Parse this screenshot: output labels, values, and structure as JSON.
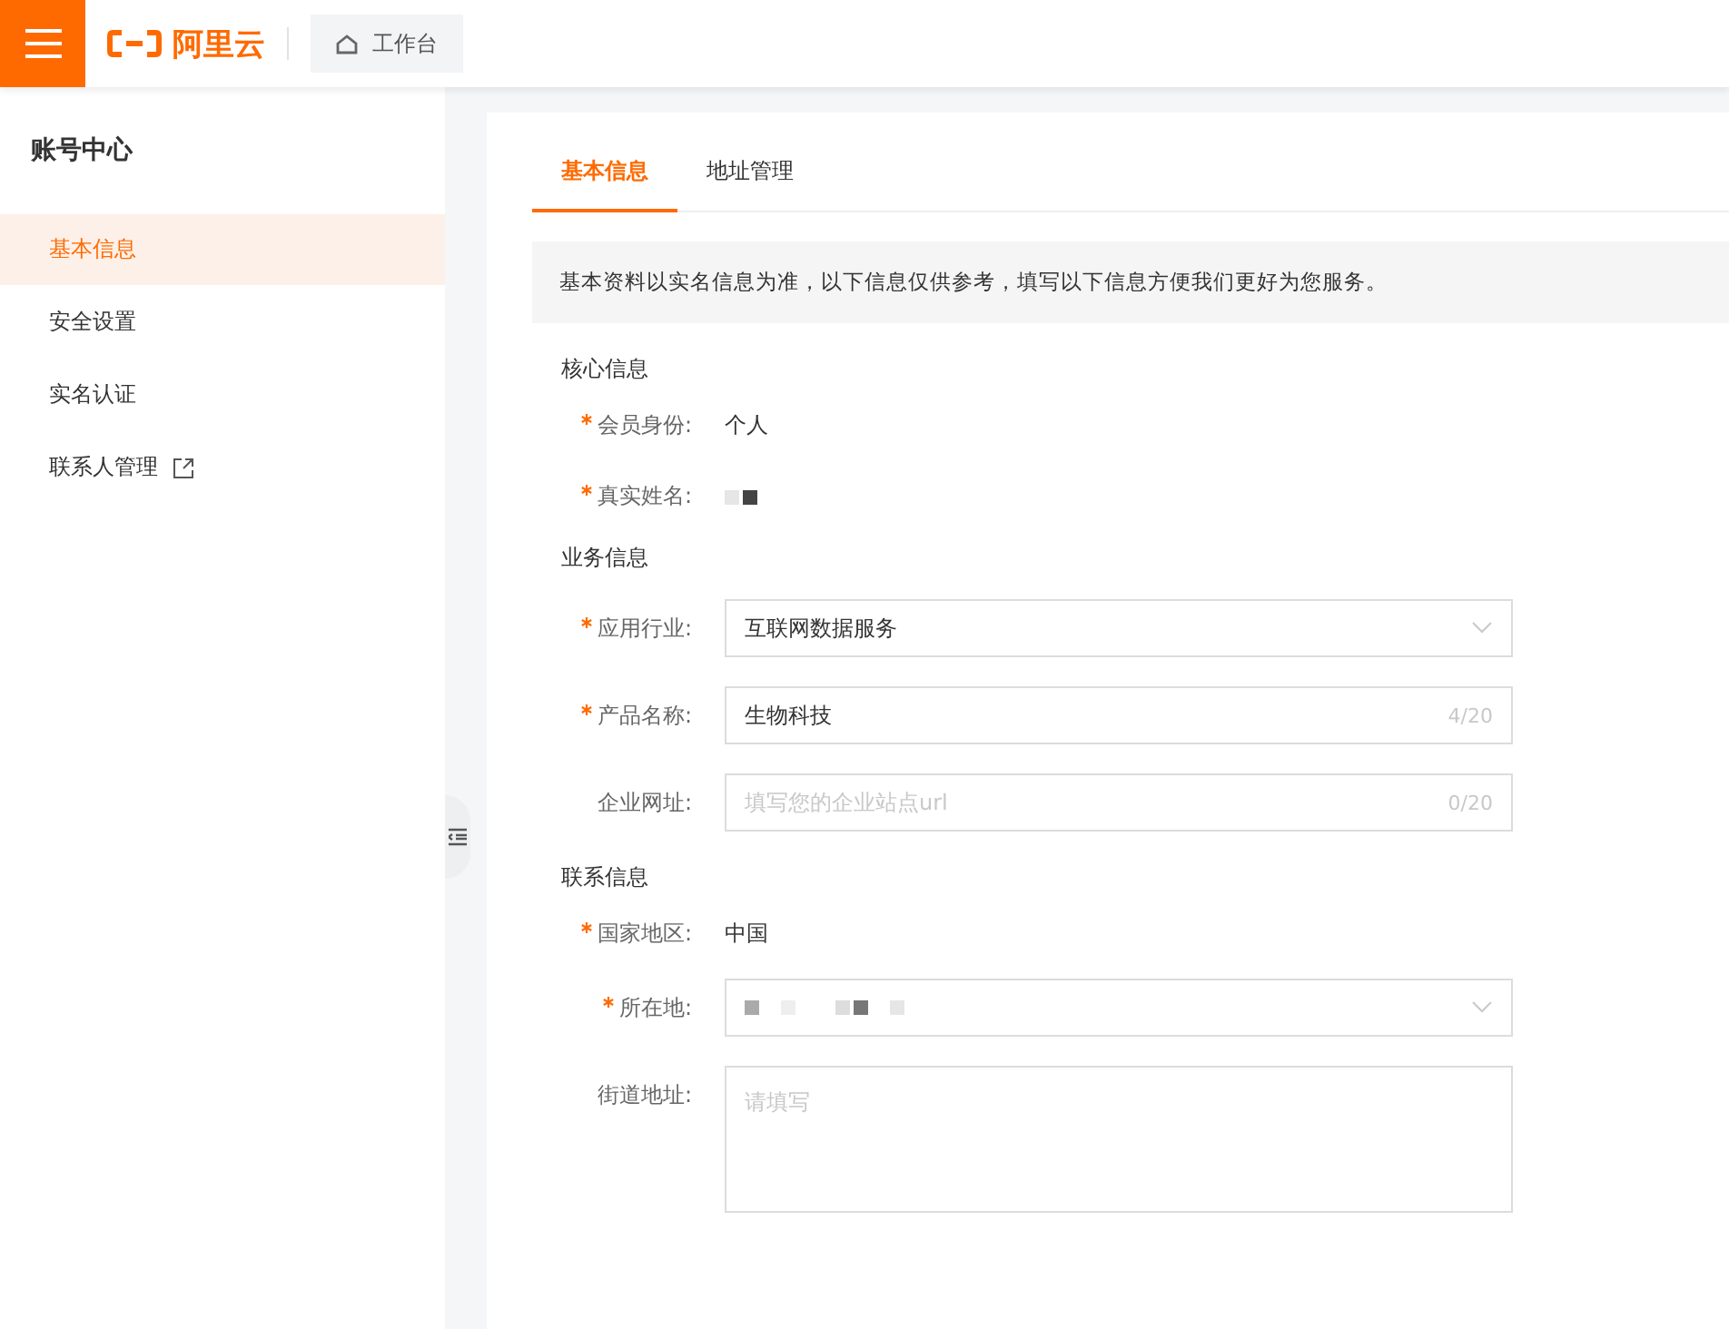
{
  "header": {
    "logo_text": "阿里云",
    "workbench_button": "工作台"
  },
  "sidebar": {
    "title": "账号中心",
    "items": [
      {
        "label": "基本信息",
        "selected": true,
        "external": false
      },
      {
        "label": "安全设置",
        "selected": false,
        "external": false
      },
      {
        "label": "实名认证",
        "selected": false,
        "external": false
      },
      {
        "label": "联系人管理",
        "selected": false,
        "external": true
      }
    ]
  },
  "tabs": [
    {
      "label": "基本信息",
      "selected": true
    },
    {
      "label": "地址管理",
      "selected": false
    }
  ],
  "notice": "基本资料以实名信息为准，以下信息仅供参考，填写以下信息方便我们更好为您服务。",
  "sections": [
    {
      "title": "核心信息",
      "fields": [
        {
          "kind": "text",
          "label": "会员身份:",
          "required": true,
          "value": "个人"
        },
        {
          "kind": "redacted",
          "label": "真实姓名:",
          "required": true
        }
      ]
    },
    {
      "title": "业务信息",
      "fields": [
        {
          "kind": "select",
          "label": "应用行业:",
          "required": true,
          "value": "互联网数据服务"
        },
        {
          "kind": "input",
          "label": "产品名称:",
          "required": true,
          "value": "生物科技",
          "counter": "4/20"
        },
        {
          "kind": "input",
          "label": "企业网址:",
          "required": false,
          "placeholder": "填写您的企业站点url",
          "counter": "0/20"
        }
      ]
    },
    {
      "title": "联系信息",
      "fields": [
        {
          "kind": "text",
          "label": "国家地区:",
          "required": true,
          "value": "中国"
        },
        {
          "kind": "redacted_select",
          "label": "所在地:",
          "required": true
        },
        {
          "kind": "textarea",
          "label": "街道地址:",
          "required": false,
          "placeholder": "请填写"
        }
      ]
    }
  ]
}
